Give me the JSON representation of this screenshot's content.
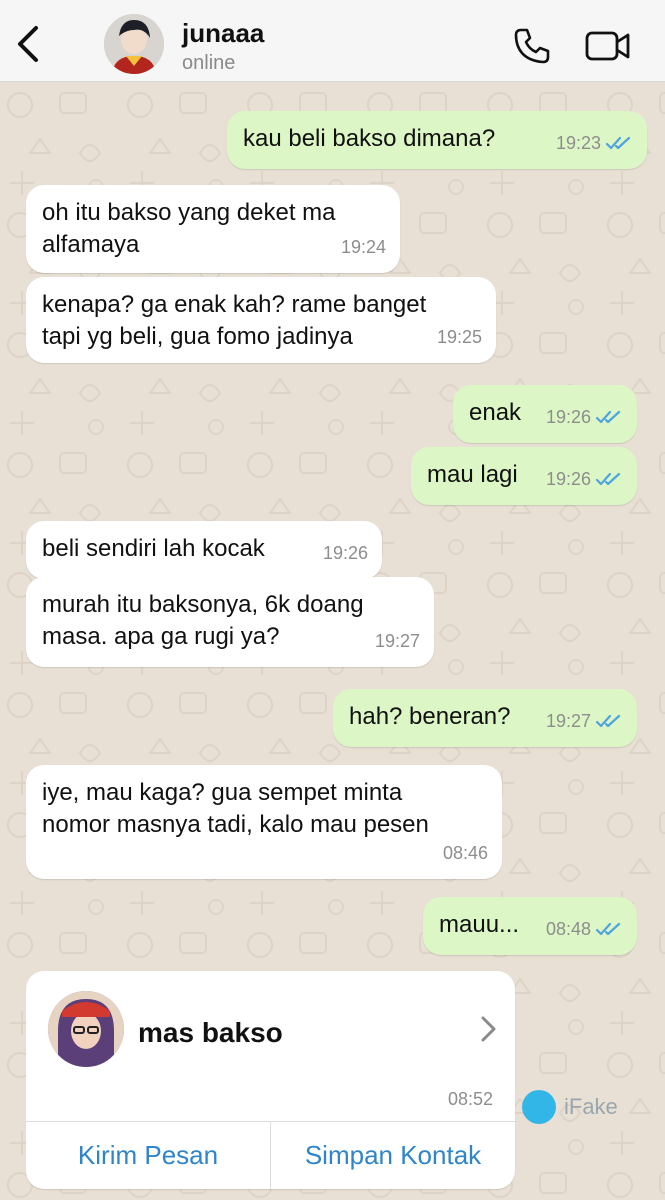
{
  "header": {
    "contact_name": "junaaa",
    "status": "online"
  },
  "messages": [
    {
      "direction": "out",
      "text": "kau beli bakso dimana?",
      "time": "19:23",
      "read": true
    },
    {
      "direction": "in",
      "text": "oh itu bakso yang deket ma\nalfamaya",
      "time": "19:24"
    },
    {
      "direction": "in",
      "text": "kenapa? ga enak kah? rame banget\ntapi yg beli, gua fomo jadinya",
      "time": "19:25"
    },
    {
      "direction": "out",
      "text": "enak",
      "time": "19:26",
      "read": true
    },
    {
      "direction": "out",
      "text": "mau lagi",
      "time": "19:26",
      "read": true
    },
    {
      "direction": "in",
      "text": "beli sendiri lah kocak",
      "time": "19:26"
    },
    {
      "direction": "in",
      "text": "murah itu baksonya, 6k doang\nmasa. apa ga rugi ya?",
      "time": "19:27"
    },
    {
      "direction": "out",
      "text": "hah? beneran?",
      "time": "19:27",
      "read": true
    },
    {
      "direction": "in",
      "text": "iye, mau kaga? gua sempet minta\nnomor masnya tadi, kalo mau pesen",
      "time": "08:46"
    },
    {
      "direction": "out",
      "text": "mauu...",
      "time": "08:48",
      "read": true
    }
  ],
  "contact_card": {
    "name": "mas bakso",
    "time": "08:52",
    "actions": [
      "Kirim Pesan",
      "Simpan Kontak"
    ]
  },
  "watermark": {
    "text": "iFake"
  },
  "colors": {
    "outgoing_bubble": "#dcf7c5",
    "incoming_bubble": "#ffffff",
    "read_ticks": "#4fa3e0",
    "link_blue": "#2f85c9",
    "wallpaper": "#e8e0d5"
  }
}
